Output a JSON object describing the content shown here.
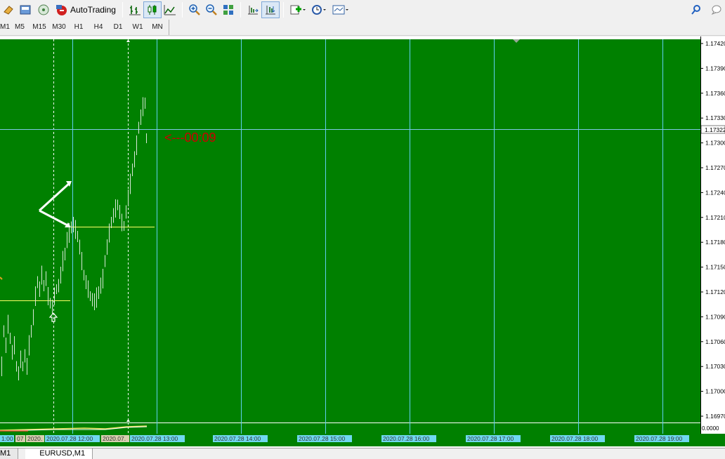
{
  "toolbar": {
    "autotrading_label": "AutoTrading"
  },
  "timeframes": [
    "M1",
    "M5",
    "M15",
    "M30",
    "H1",
    "H4",
    "D1",
    "W1",
    "MN"
  ],
  "chart": {
    "background": "#008000",
    "grid_color": "#5fd0f0",
    "price_labels": [
      "1.17420",
      "1.17390",
      "1.17360",
      "1.17330",
      "1.17300",
      "1.17270",
      "1.17240",
      "1.17210",
      "1.17180",
      "1.17150",
      "1.17120",
      "1.17090",
      "1.17060",
      "1.17030",
      "1.17000",
      "1.16970"
    ],
    "current_price": "1.17322",
    "countdown": "<---00:09",
    "countdown_color": "#cc0000",
    "indicator_label": "0.0000",
    "time_labels": [
      "1:00",
      "07",
      "2020.",
      "2020.07.28 12:00",
      "2020.07.",
      "2020.07.28 13:00",
      "2020.07.28 14:00",
      "2020.07.28 15:00",
      "2020.07.28 16:00",
      "2020.07.28 17:00",
      "2020.07.28 18:00",
      "2020.07.28 19:00"
    ]
  },
  "tabs": [
    "M1",
    "EURUSD,M1"
  ]
}
